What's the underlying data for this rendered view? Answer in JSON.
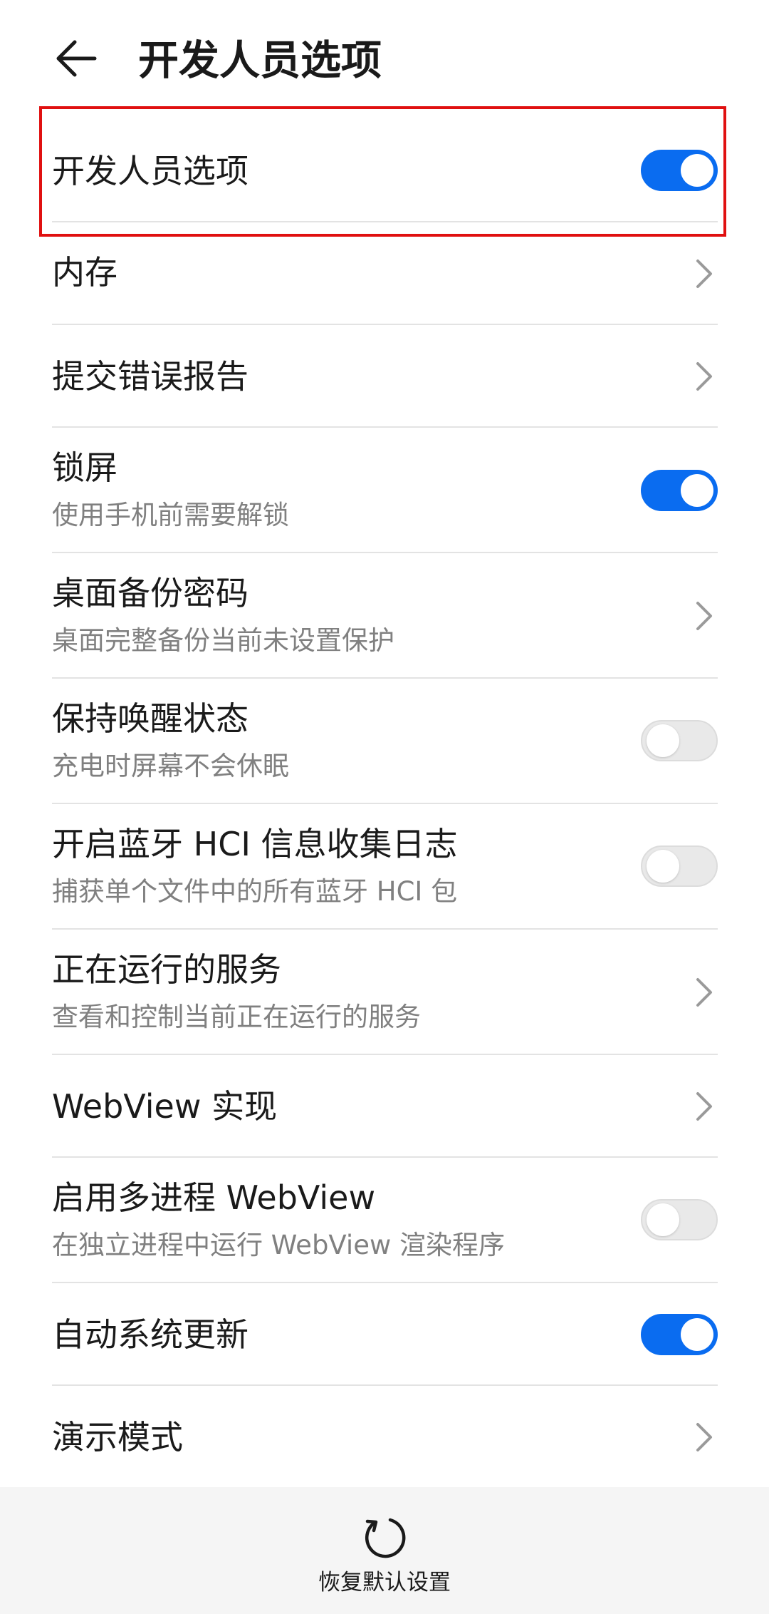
{
  "header": {
    "title": "开发人员选项",
    "back_icon": "arrow-left-icon"
  },
  "rows": [
    {
      "title": "开发人员选项",
      "control": "toggle",
      "state": "on"
    },
    {
      "title": "内存",
      "control": "chevron"
    },
    {
      "title": "提交错误报告",
      "control": "chevron"
    },
    {
      "title": "锁屏",
      "subtitle": "使用手机前需要解锁",
      "control": "toggle",
      "state": "on"
    },
    {
      "title": "桌面备份密码",
      "subtitle": "桌面完整备份当前未设置保护",
      "control": "chevron"
    },
    {
      "title": "保持唤醒状态",
      "subtitle": "充电时屏幕不会休眠",
      "control": "toggle",
      "state": "off"
    },
    {
      "title": "开启蓝牙 HCI 信息收集日志",
      "subtitle": "捕获单个文件中的所有蓝牙 HCI 包",
      "control": "toggle",
      "state": "off"
    },
    {
      "title": "正在运行的服务",
      "subtitle": "查看和控制当前正在运行的服务",
      "control": "chevron"
    },
    {
      "title": "WebView 实现",
      "control": "chevron"
    },
    {
      "title": "启用多进程 WebView",
      "subtitle": "在独立进程中运行 WebView 渲染程序",
      "control": "toggle",
      "state": "off"
    },
    {
      "title": "自动系统更新",
      "control": "toggle",
      "state": "on"
    },
    {
      "title": "演示模式",
      "control": "chevron"
    }
  ],
  "footer": {
    "reset_label": "恢复默认设置",
    "reset_icon": "refresh-icon"
  },
  "colors": {
    "accent": "#0a6cf0",
    "highlight": "#e01010",
    "divider": "#e3e3e3",
    "subtitle": "#808080",
    "footer_bg": "#f5f5f5"
  }
}
